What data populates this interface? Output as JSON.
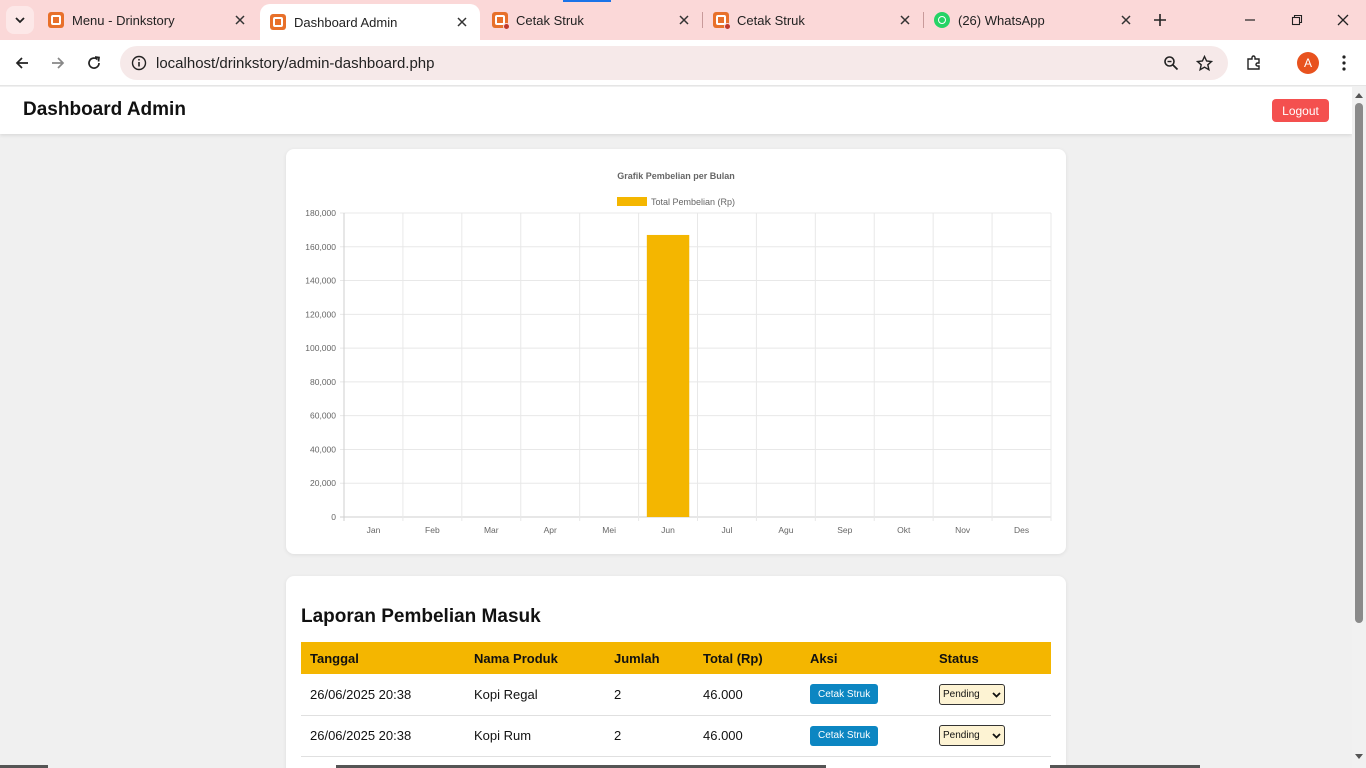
{
  "browser": {
    "tabs": [
      {
        "title": "Menu - Drinkstory",
        "icon": "xampp-icon",
        "active": false
      },
      {
        "title": "Dashboard Admin",
        "icon": "xampp-icon",
        "active": true
      },
      {
        "title": "Cetak Struk",
        "icon": "xampp-icon",
        "active": false
      },
      {
        "title": "Cetak Struk",
        "icon": "xampp-icon",
        "active": false
      },
      {
        "title": "(26) WhatsApp",
        "icon": "whatsapp-icon",
        "active": false
      }
    ],
    "url": "localhost/drinkstory/admin-dashboard.php",
    "profile_initial": "A"
  },
  "page": {
    "title": "Dashboard Admin",
    "logout_label": "Logout"
  },
  "chart_data": {
    "type": "bar",
    "title": "Grafik Pembelian per Bulan",
    "legend": "Total Pembelian (Rp)",
    "legend_position": "top",
    "categories": [
      "Jan",
      "Feb",
      "Mar",
      "Apr",
      "Mei",
      "Jun",
      "Jul",
      "Agu",
      "Sep",
      "Okt",
      "Nov",
      "Des"
    ],
    "series": [
      {
        "name": "Total Pembelian (Rp)",
        "values": [
          0,
          0,
          0,
          0,
          0,
          167000,
          0,
          0,
          0,
          0,
          0,
          0
        ]
      }
    ],
    "yticks": [
      "0",
      "20,000",
      "40,000",
      "60,000",
      "80,000",
      "100,000",
      "120,000",
      "140,000",
      "160,000",
      "180,000"
    ],
    "ylim": [
      0,
      180000
    ],
    "grid": true,
    "color": "#f4b600"
  },
  "report": {
    "title": "Laporan Pembelian Masuk",
    "columns": [
      "Tanggal",
      "Nama Produk",
      "Jumlah",
      "Total (Rp)",
      "Aksi",
      "Status"
    ],
    "rows": [
      {
        "tanggal": "26/06/2025 20:38",
        "produk": "Kopi Regal",
        "jumlah": "2",
        "total": "46.000",
        "aksi": "Cetak Struk",
        "status": "Pending"
      },
      {
        "tanggal": "26/06/2025 20:38",
        "produk": "Kopi Rum",
        "jumlah": "2",
        "total": "46.000",
        "aksi": "Cetak Struk",
        "status": "Pending"
      }
    ]
  }
}
